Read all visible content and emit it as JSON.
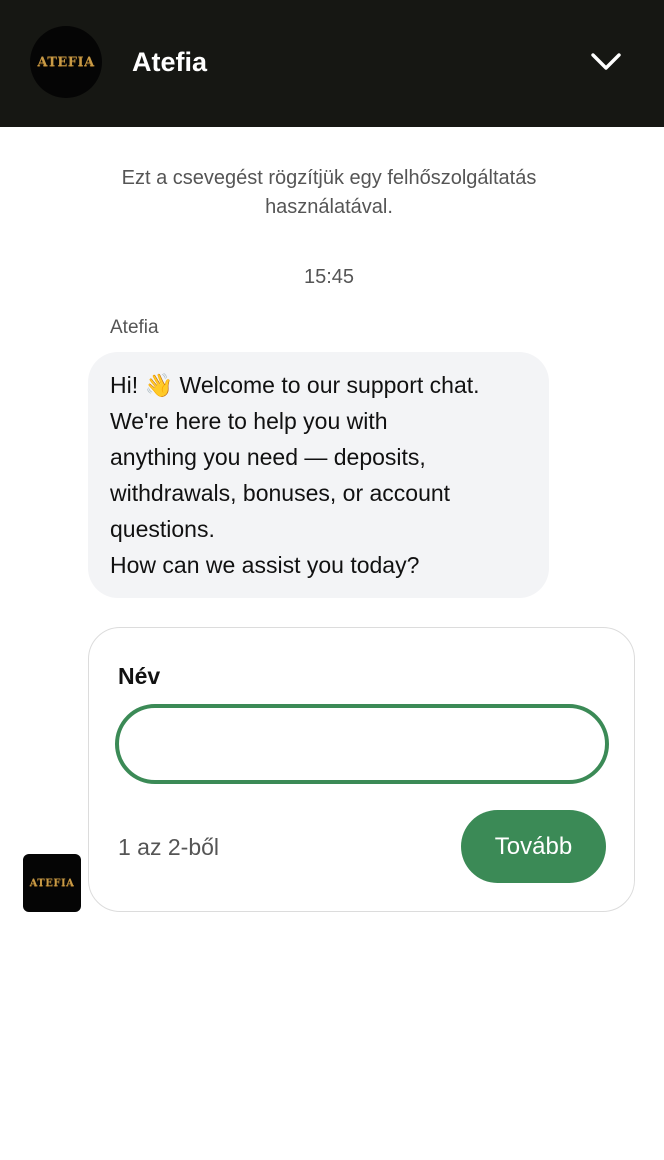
{
  "header": {
    "title": "Atefia",
    "logo_text": "ATEFIA",
    "collapse_icon": "chevron-down-icon"
  },
  "notice": "Ezt a csevegést rögzítjük egy felhőszolgáltatás használatával.",
  "timestamp": "15:45",
  "message": {
    "sender": "Atefia",
    "lines": [
      "Hi! 👋 Welcome to our support chat.",
      "We're here to help you with",
      "anything you need — deposits,",
      "withdrawals, bonuses, or account",
      "questions.",
      "How can we assist you today?"
    ]
  },
  "form": {
    "field_label": "Név",
    "name_value": "",
    "step": "1 az 2-ből",
    "next_label": "Tovább"
  },
  "bot_avatar": {
    "logo_text": "ATEFIA"
  },
  "colors": {
    "header_bg": "#161713",
    "accent_green": "#3b8a56",
    "bubble_bg": "#f3f4f6",
    "logo_gold": "#c99a45"
  }
}
